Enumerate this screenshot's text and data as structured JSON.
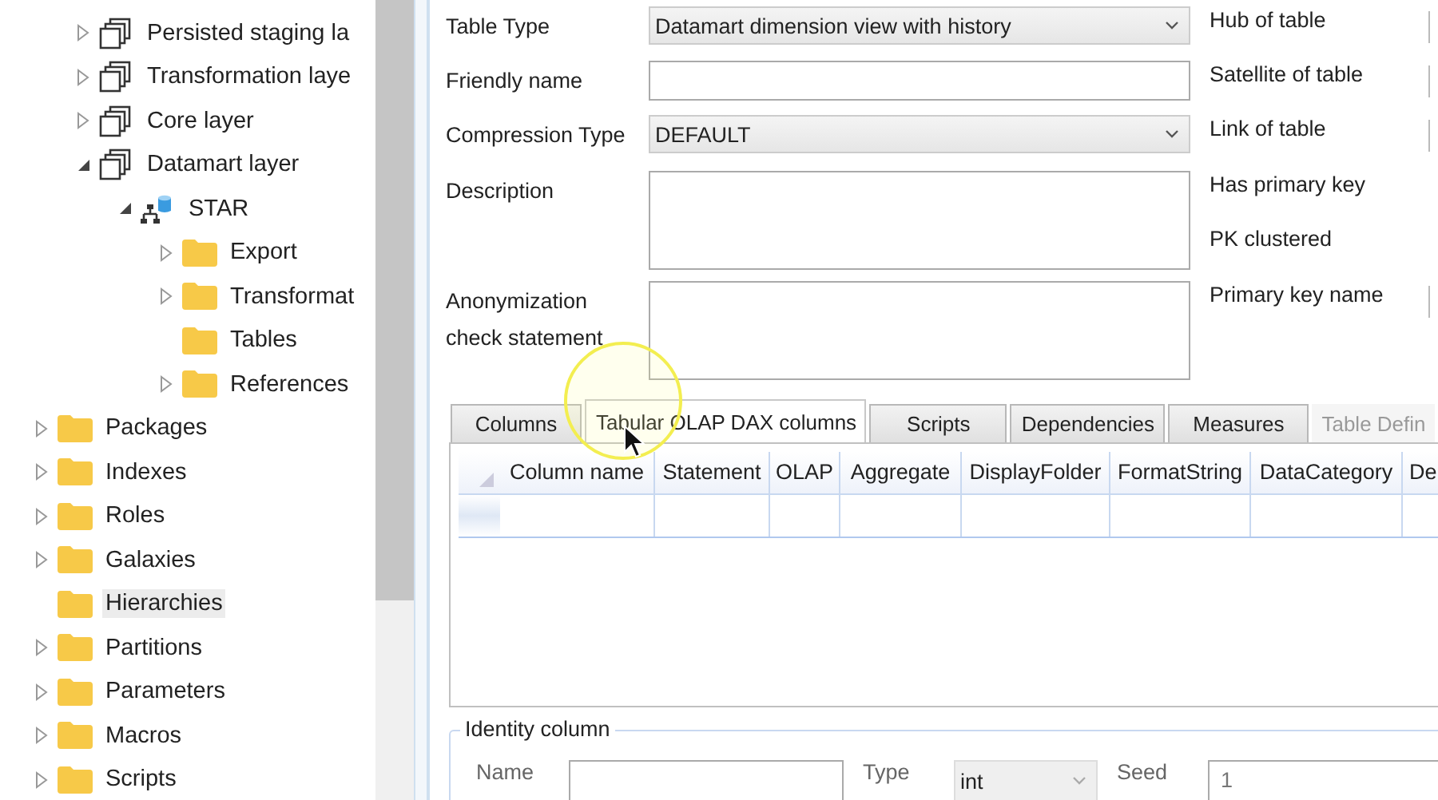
{
  "tree": {
    "continued_children": [
      {
        "label": "Persisted staging la",
        "kind": "layer",
        "expanded": false,
        "selected": false
      },
      {
        "label": "Transformation laye",
        "kind": "layer",
        "expanded": false,
        "selected": false
      },
      {
        "label": "Core layer",
        "kind": "layer",
        "expanded": false,
        "selected": false
      },
      {
        "label": "Datamart layer",
        "kind": "layer",
        "expanded": true,
        "selected": false,
        "children": [
          {
            "label": "STAR",
            "kind": "database",
            "expanded": true,
            "selected": false,
            "children": [
              {
                "label": "Export",
                "kind": "folder",
                "expanded": false,
                "selected": false
              },
              {
                "label": "Transformat",
                "kind": "folder",
                "expanded": false,
                "selected": false
              },
              {
                "label": "Tables",
                "kind": "folder",
                "selected": false
              },
              {
                "label": "References",
                "kind": "folder",
                "expanded": false,
                "selected": false
              }
            ]
          }
        ]
      }
    ],
    "items": [
      {
        "label": "Packages",
        "kind": "folder",
        "expanded": false,
        "selected": false
      },
      {
        "label": "Indexes",
        "kind": "folder",
        "expanded": false,
        "selected": false
      },
      {
        "label": "Roles",
        "kind": "folder",
        "expanded": false,
        "selected": false
      },
      {
        "label": "Galaxies",
        "kind": "folder",
        "expanded": false,
        "selected": false
      },
      {
        "label": "Hierarchies",
        "kind": "folder",
        "selected": true
      },
      {
        "label": "Partitions",
        "kind": "folder",
        "expanded": false,
        "selected": false
      },
      {
        "label": "Parameters",
        "kind": "folder",
        "expanded": false,
        "selected": false
      },
      {
        "label": "Macros",
        "kind": "folder",
        "expanded": false,
        "selected": false
      },
      {
        "label": "Scripts",
        "kind": "folder",
        "expanded": false,
        "selected": false
      }
    ]
  },
  "form": {
    "fields": [
      {
        "label": "Table Type",
        "kind": "dropdown",
        "value": "Datamart dimension view with history"
      },
      {
        "label": "Friendly name",
        "kind": "text"
      },
      {
        "label": "Compression Type",
        "kind": "dropdown",
        "value": "DEFAULT"
      },
      {
        "label": "Description",
        "kind": "multiline"
      },
      {
        "label": "Anonymization check statement",
        "kind": "multiline"
      }
    ],
    "side_fields": [
      {
        "label": "Hub of table",
        "kind": "field"
      },
      {
        "label": "Satellite of table",
        "kind": "field"
      },
      {
        "label": "Link of table",
        "kind": "field"
      },
      {
        "label": "Has primary key",
        "kind": "flag"
      },
      {
        "label": "PK clustered",
        "kind": "flag"
      },
      {
        "label": "Primary key name",
        "kind": "field"
      }
    ]
  },
  "tabs": [
    {
      "label": "Columns",
      "selected": false,
      "disabled": false
    },
    {
      "label": "Tabular OLAP DAX columns",
      "selected": true,
      "disabled": false
    },
    {
      "label": "Scripts",
      "selected": false,
      "disabled": false
    },
    {
      "label": "Dependencies",
      "selected": false,
      "disabled": false
    },
    {
      "label": "Measures",
      "selected": false,
      "disabled": false
    },
    {
      "label": "Table Defin",
      "selected": false,
      "disabled": true
    }
  ],
  "table": {
    "columns": [
      "Column name",
      "Statement",
      "OLAP",
      "Aggregate",
      "DisplayFolder",
      "FormatString",
      "DataCategory",
      "De"
    ]
  },
  "identity_column": {
    "title": "Identity column",
    "name_label": "Name",
    "type_label": "Type",
    "type_value": "int",
    "seed_label": "Seed",
    "seed_value": "1"
  }
}
